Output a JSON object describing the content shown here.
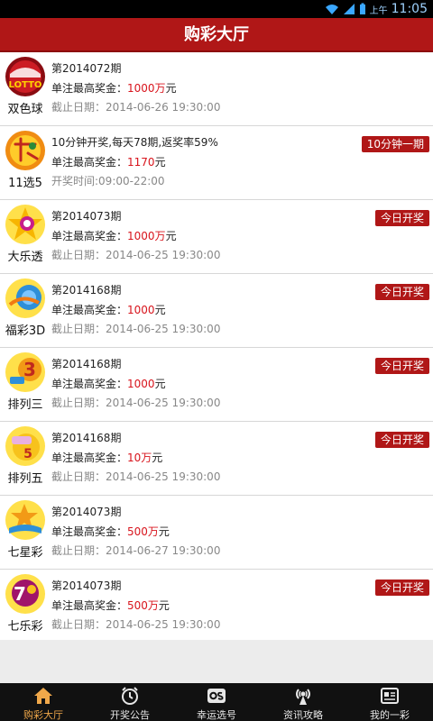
{
  "status_bar": {
    "ampm": "上午",
    "time": "11:05"
  },
  "title": "购彩大厅",
  "prize_label": "单注最高奖金：",
  "lotteries": [
    {
      "name": "双色球",
      "icon": "shuangseqiu-logo-icon",
      "period": "第2014072期",
      "prize": "1000万",
      "unit": "元",
      "deadline": "截止日期：2014-06-26 19:30:00",
      "badge": ""
    },
    {
      "name": "11选5",
      "icon": "11xuan5-logo-icon",
      "period": "10分钟开奖,每天78期,返奖率59%",
      "prize": "1170",
      "unit": "元",
      "deadline": "开奖时间:09:00-22:00",
      "badge": "10分钟一期"
    },
    {
      "name": "大乐透",
      "icon": "daletou-logo-icon",
      "period": "第2014073期",
      "prize": "1000万",
      "unit": "元",
      "deadline": "截止日期：2014-06-25 19:30:00",
      "badge": "今日开奖"
    },
    {
      "name": "福彩3D",
      "icon": "fucai3d-logo-icon",
      "period": "第2014168期",
      "prize": "1000",
      "unit": "元",
      "deadline": "截止日期：2014-06-25 19:30:00",
      "badge": "今日开奖"
    },
    {
      "name": "排列三",
      "icon": "pailie3-logo-icon",
      "period": "第2014168期",
      "prize": "1000",
      "unit": "元",
      "deadline": "截止日期：2014-06-25 19:30:00",
      "badge": "今日开奖"
    },
    {
      "name": "排列五",
      "icon": "pailie5-logo-icon",
      "period": "第2014168期",
      "prize": "10万",
      "unit": "元",
      "deadline": "截止日期：2014-06-25 19:30:00",
      "badge": "今日开奖"
    },
    {
      "name": "七星彩",
      "icon": "qixingcai-logo-icon",
      "period": "第2014073期",
      "prize": "500万",
      "unit": "元",
      "deadline": "截止日期：2014-06-27 19:30:00",
      "badge": ""
    },
    {
      "name": "七乐彩",
      "icon": "qilecai-logo-icon",
      "period": "第2014073期",
      "prize": "500万",
      "unit": "元",
      "deadline": "截止日期：2014-06-25 19:30:00",
      "badge": "今日开奖"
    }
  ],
  "logo_text": {
    "shuangseqiu": "LOTTO",
    "pailie3": "3",
    "pailie5": "5",
    "qilecai": "7"
  },
  "tabs": [
    {
      "label": "购彩大厅",
      "icon": "home-icon",
      "active": true
    },
    {
      "label": "开奖公告",
      "icon": "alarm-clock-icon",
      "active": false
    },
    {
      "label": "幸运选号",
      "icon": "lucky-pick-icon",
      "active": false
    },
    {
      "label": "资讯攻略",
      "icon": "broadcast-icon",
      "active": false
    },
    {
      "label": "我的一彩",
      "icon": "profile-card-icon",
      "active": false
    }
  ],
  "colors": {
    "brand_red": "#b01717",
    "prize_red": "#d8141c",
    "tab_active": "#f0a84a"
  }
}
